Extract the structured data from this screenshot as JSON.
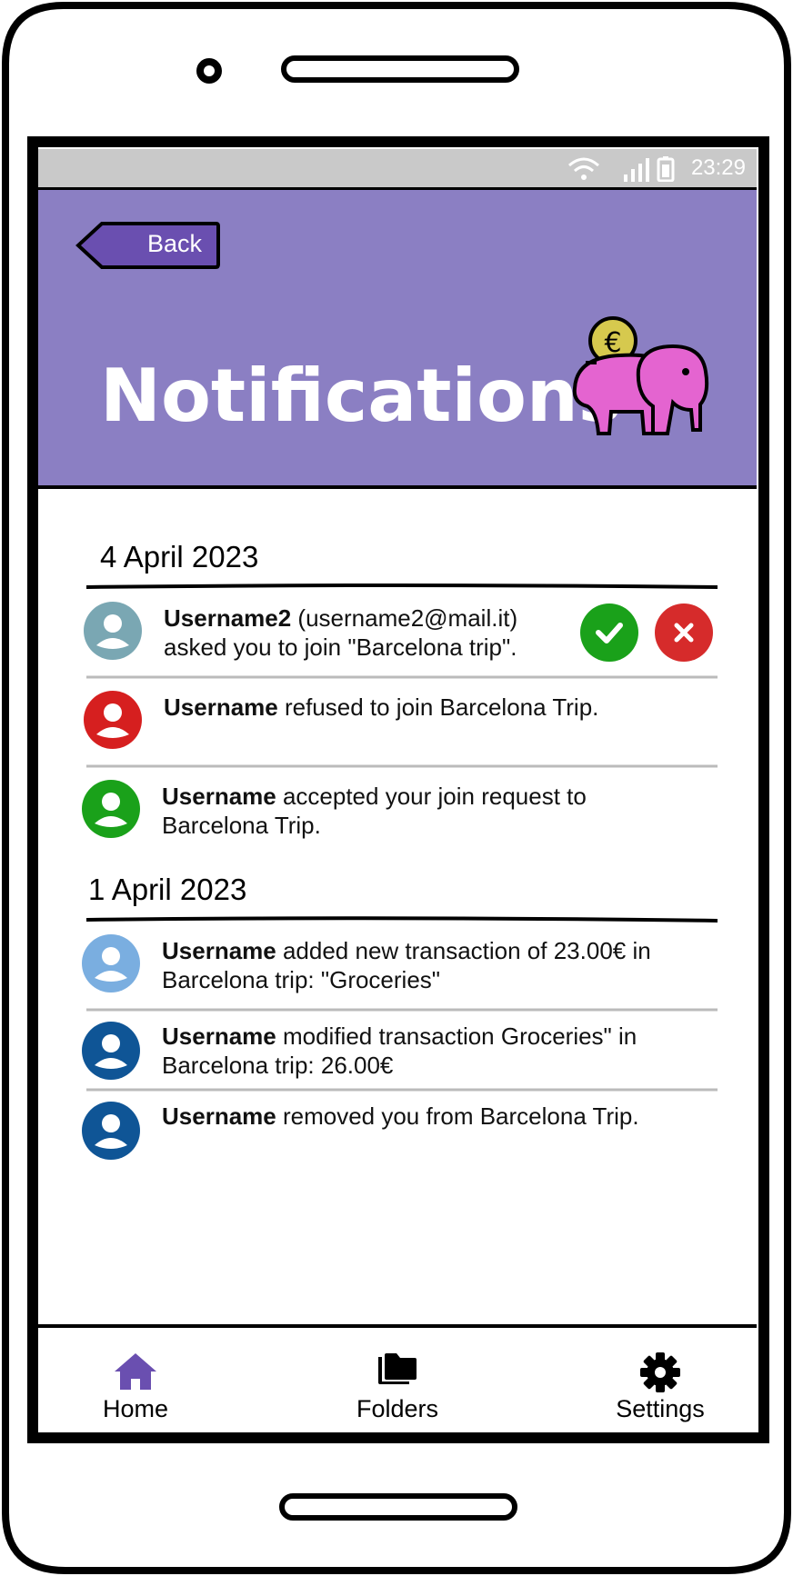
{
  "status_bar": {
    "time": "23:29"
  },
  "header": {
    "back_label": "Back",
    "title": "Notifications"
  },
  "groups": [
    {
      "date": "4 April 2023",
      "items": [
        {
          "user": "Username2",
          "text_line1": " (username2@mail.it)",
          "text_line2": "asked you to join \"Barcelona trip\".",
          "avatar_color": "#7aa7b3"
        },
        {
          "user": "Username",
          "text_line1": " refused to join Barcelona Trip.",
          "text_line2": "",
          "avatar_color": "#d61f1f"
        },
        {
          "user": "Username",
          "text_line1": " accepted your join request to",
          "text_line2": "Barcelona Trip.",
          "avatar_color": "#1aa11a"
        }
      ]
    },
    {
      "date": "1 April 2023",
      "items": [
        {
          "user": "Username",
          "text_line1": " added new transaction of 23.00€ in",
          "text_line2": "Barcelona trip: \"Groceries\"",
          "avatar_color": "#7aaee0"
        },
        {
          "user": "Username",
          "text_line1": " modified transaction Groceries\" in",
          "text_line2": "Barcelona trip: 26.00€",
          "avatar_color": "#0f5596"
        },
        {
          "user": "Username",
          "text_line1": " removed you from Barcelona Trip.",
          "text_line2": "",
          "avatar_color": "#0f5596"
        }
      ]
    }
  ],
  "colors": {
    "accept": "#1aa11a",
    "decline": "#d62b2b",
    "header_bg": "#8b7fc3",
    "accent": "#6a4fb0"
  },
  "tabs": [
    {
      "label": "Home",
      "icon": "home-icon"
    },
    {
      "label": "Folders",
      "icon": "folder-icon"
    },
    {
      "label": "Settings",
      "icon": "gear-icon"
    }
  ]
}
